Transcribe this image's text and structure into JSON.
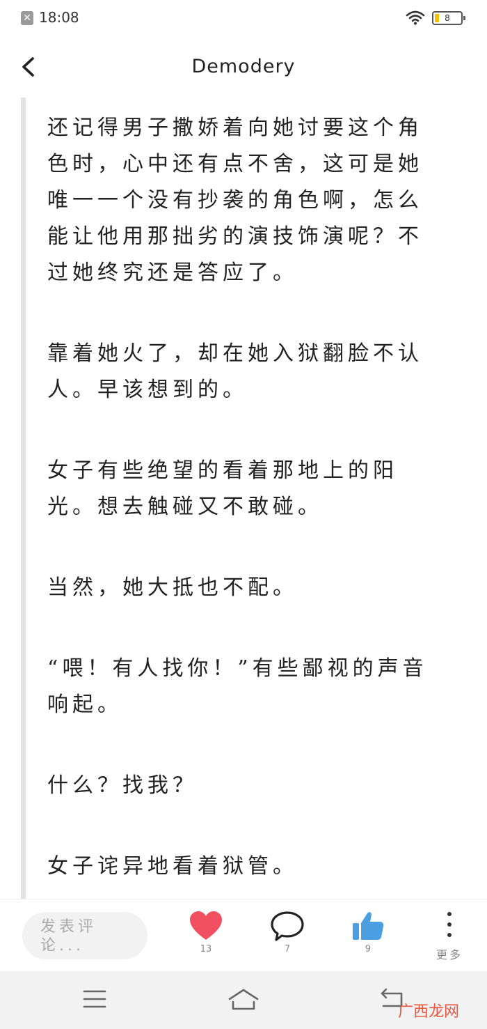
{
  "status_bar": {
    "time": "18:08",
    "battery_level": "8",
    "notification_icon": "close-x-icon",
    "wifi_icon": "wifi-icon"
  },
  "header": {
    "title": "Demodery",
    "back_icon": "chevron-left-icon"
  },
  "content": {
    "paragraphs": [
      "还记得男子撒娇着向她讨要这个角色时，心中还有点不舍，这可是她唯一一个没有抄袭的角色啊，怎么能让他用那拙劣的演技饰演呢？不过她终究还是答应了。",
      "靠着她火了，却在她入狱翻脸不认人。早该想到的。",
      "女子有些绝望的看着那地上的阳光。想去触碰又不敢碰。",
      "当然，她大抵也不配。",
      "“喂！有人找你！”有些鄙视的声音响起。",
      "什么？找我？",
      "女子诧异地看着狱管。"
    ]
  },
  "toolbar": {
    "comment_placeholder": "发表评论...",
    "like_count": "13",
    "comment_count": "7",
    "thumbs_count": "9",
    "more_label": "更多",
    "colors": {
      "heart": "#f0505f",
      "thumb": "#4a9fe3"
    }
  },
  "nav": {
    "menu_icon": "menu-icon",
    "home_icon": "home-icon",
    "back_icon": "back-icon"
  },
  "watermark": "广西龙网"
}
